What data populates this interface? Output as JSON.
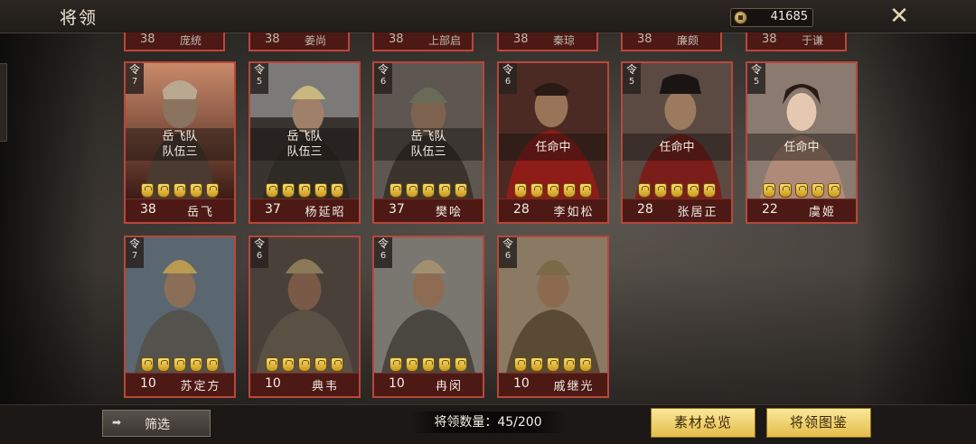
{
  "header": {
    "title": "将领",
    "currency_value": "41685"
  },
  "partial_row": [
    {
      "level": "38",
      "name": "庞统"
    },
    {
      "level": "38",
      "name": "姜尚"
    },
    {
      "level": "38",
      "name": "上部启"
    },
    {
      "level": "38",
      "name": "秦琼"
    },
    {
      "level": "38",
      "name": "廉颇"
    },
    {
      "level": "38",
      "name": "于谦"
    }
  ],
  "row1": [
    {
      "cmd_label": "令",
      "cmd": "7",
      "status_line1": "岳飞队",
      "status_line2": "队伍三",
      "stars": 5,
      "level": "38",
      "name": "岳飞"
    },
    {
      "cmd_label": "令",
      "cmd": "5",
      "status_line1": "岳飞队",
      "status_line2": "队伍三",
      "stars": 5,
      "level": "37",
      "name": "杨延昭"
    },
    {
      "cmd_label": "令",
      "cmd": "6",
      "status_line1": "岳飞队",
      "status_line2": "队伍三",
      "stars": 5,
      "level": "37",
      "name": "樊哙"
    },
    {
      "cmd_label": "令",
      "cmd": "6",
      "status_line1": "任命中",
      "stars": 5,
      "level": "28",
      "name": "李如松"
    },
    {
      "cmd_label": "令",
      "cmd": "5",
      "status_line1": "任命中",
      "stars": 5,
      "level": "28",
      "name": "张居正"
    },
    {
      "cmd_label": "令",
      "cmd": "5",
      "status_line1": "任命中",
      "stars": 5,
      "level": "22",
      "name": "虞姬"
    }
  ],
  "row2": [
    {
      "cmd_label": "令",
      "cmd": "7",
      "stars": 5,
      "level": "10",
      "name": "苏定方"
    },
    {
      "cmd_label": "令",
      "cmd": "6",
      "stars": 5,
      "level": "10",
      "name": "典韦"
    },
    {
      "cmd_label": "令",
      "cmd": "6",
      "stars": 5,
      "level": "10",
      "name": "冉闵"
    },
    {
      "cmd_label": "令",
      "cmd": "6",
      "stars": 5,
      "level": "10",
      "name": "戚继光"
    }
  ],
  "footer": {
    "filter_label": "筛选",
    "count_label": "将领数量：",
    "count_value": "45/200",
    "materials_label": "素材总览",
    "codex_label": "将领图鉴"
  },
  "icons": {
    "currency": "coin-icon",
    "close": "close-icon",
    "filter": "arrow-icon",
    "star": "star-badge-icon"
  },
  "colors": {
    "card_border": "#b8473b",
    "gold_button": "#f3d46f",
    "star_gold": "#e8c040"
  }
}
